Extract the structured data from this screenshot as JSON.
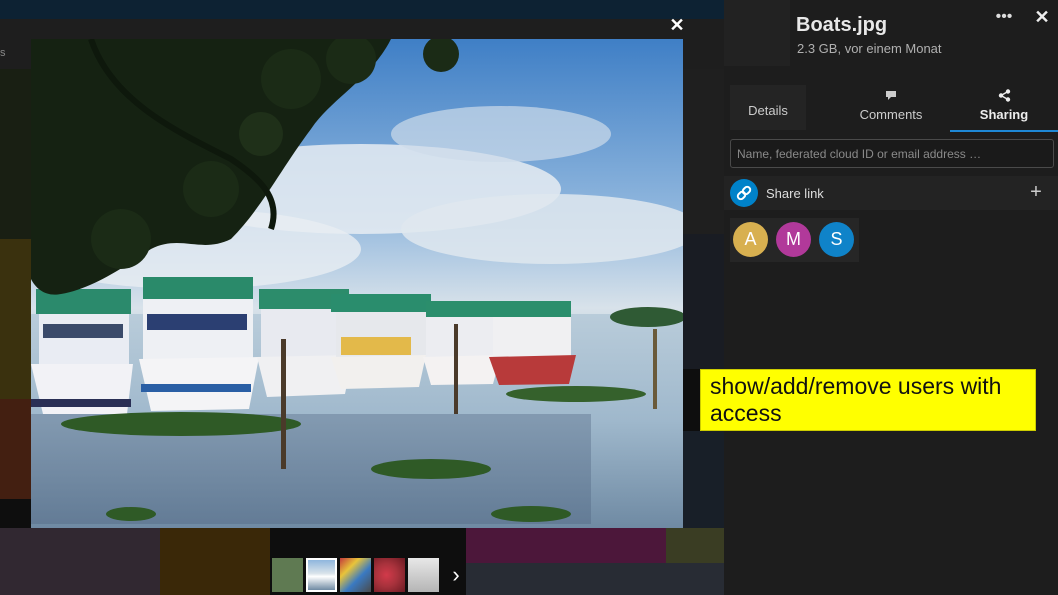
{
  "background": {
    "header_fragment": "s"
  },
  "viewer": {
    "close_glyph": "✕",
    "next_glyph": "›",
    "thumbnails": [
      {
        "name": "thumb-1",
        "color": "#5f7a52",
        "active": false
      },
      {
        "name": "thumb-2",
        "color": "#8fa9c2",
        "active": true
      },
      {
        "name": "thumb-3",
        "color": "#7a6a5a",
        "active": false
      },
      {
        "name": "thumb-4",
        "color": "#a8323c",
        "active": false
      },
      {
        "name": "thumb-5",
        "color": "#cfcfcf",
        "active": false
      }
    ]
  },
  "sidebar": {
    "file_title": "Boats.jpg",
    "file_meta": "2.3 GB, vor einem Monat",
    "more_glyph": "•••",
    "close_glyph": "✕",
    "tabs": {
      "details": "Details",
      "comments": "Comments",
      "sharing": "Sharing"
    },
    "share_input_placeholder": "Name, federated cloud ID or email address …",
    "share_link_label": "Share link",
    "add_glyph": "+",
    "avatars": [
      {
        "letter": "A",
        "color": "#d8b050"
      },
      {
        "letter": "M",
        "color": "#b1399a"
      },
      {
        "letter": "S",
        "color": "#0f83c9"
      }
    ]
  },
  "annotation": {
    "text": "show/add/remove users with access"
  },
  "colors": {
    "accent": "#1e88d6",
    "sidebar_bg": "#1d1d1d",
    "annotation_bg": "#ffff00"
  }
}
